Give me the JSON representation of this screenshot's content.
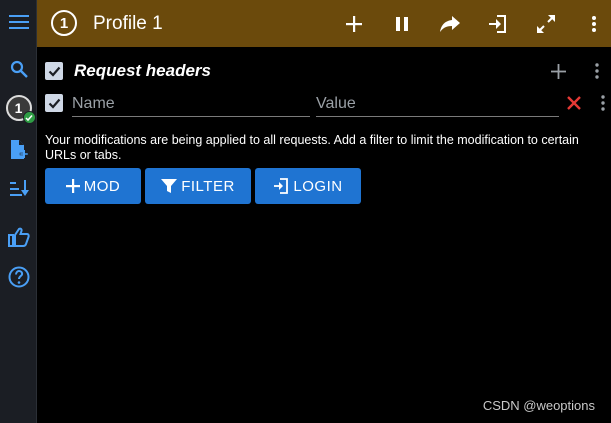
{
  "sidebar": {
    "profile_number": "1"
  },
  "header": {
    "profile_number": "1",
    "title": "Profile 1"
  },
  "section": {
    "title": "Request headers"
  },
  "header_row": {
    "name_placeholder": "Name",
    "value_placeholder": "Value"
  },
  "notice": "Your modifications are being applied to all requests. Add a filter to limit the modification to certain URLs or tabs.",
  "buttons": {
    "mod": "MOD",
    "filter": "FILTER",
    "login": "LOGIN"
  },
  "watermark": "CSDN @weoptions",
  "colors": {
    "topbar": "#6b4a0c",
    "sidebar": "#1b1e24",
    "accent_blue": "#1f74d2",
    "icon_blue": "#4a9ff5",
    "delete_red": "#e53935",
    "success_green": "#2e9d44"
  }
}
